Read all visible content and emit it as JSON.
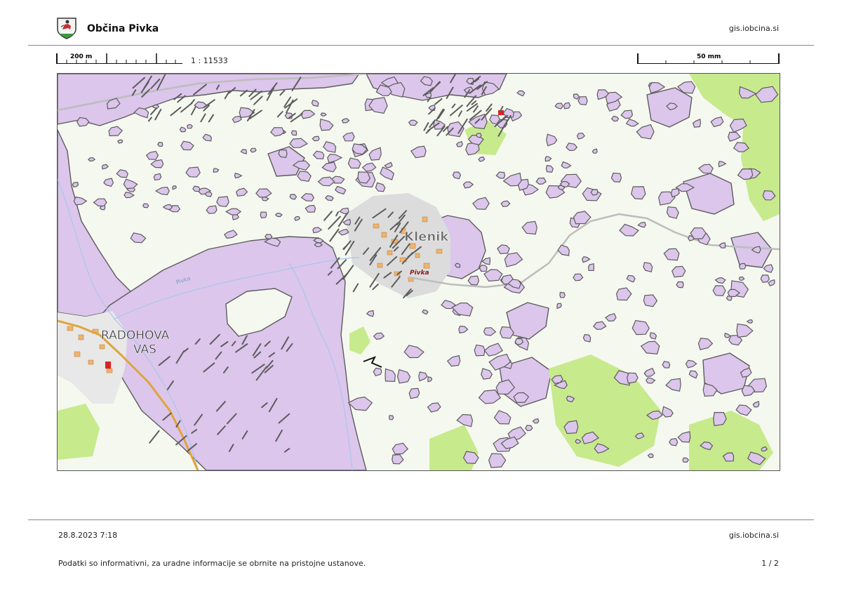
{
  "header": {
    "title": "Občina Pivka",
    "url": "gis.iobcina.si"
  },
  "scale": {
    "bar_label": "200 m",
    "ratio": "1 : 11533",
    "paper_bar_label": "50 mm"
  },
  "map": {
    "place_labels": [
      "Klenik",
      "RADOHOVA VAS"
    ],
    "place_label_lines": [
      "RADOHOVA",
      "VAS"
    ],
    "river_labels": [
      "Pivka",
      "Pivka"
    ],
    "colors": {
      "forest": "#dcc6ec",
      "forest_outline": "#5c5c5c",
      "meadow": "#c7ea8c",
      "field": "#f5f8ef",
      "settlement": "#dcdcdc",
      "building": "#f0b36a",
      "road_main": "#e0a43a",
      "road_local": "#bdbdbd",
      "river": "#a9c7e8",
      "highlight": "#e02020"
    }
  },
  "footer": {
    "date": "28.8.2023 7:18",
    "url": "gis.iobcina.si",
    "disclaimer": "Podatki so informativni, za uradne informacije se obrnite na pristojne ustanove.",
    "page": "1 / 2"
  }
}
